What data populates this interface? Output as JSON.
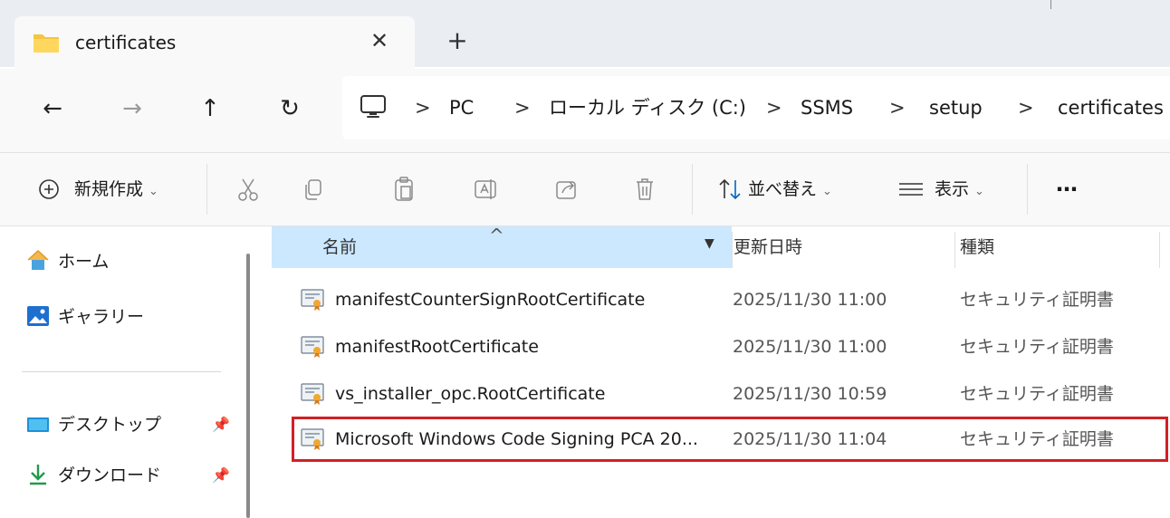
{
  "tab": {
    "title": "certificates",
    "close_glyph": "✕",
    "new_tab_glyph": "+",
    "folder_icon": "folder-icon"
  },
  "nav": {
    "back_glyph": "←",
    "forward_glyph": "→",
    "up_glyph": "↑",
    "refresh_glyph": "↻"
  },
  "breadcrumb": {
    "separator": ">",
    "items": [
      "PC",
      "ローカル ディスク (C:)",
      "SSMS",
      "setup",
      "certificates"
    ]
  },
  "toolbar": {
    "new_label": "新規作成",
    "sort_label": "並べ替え",
    "view_label": "表示",
    "more_glyph": "⋯",
    "chevron": "⌄"
  },
  "sidebar": {
    "items": [
      {
        "label": "ホーム",
        "icon": "home-icon"
      },
      {
        "label": "ギャラリー",
        "icon": "gallery-icon"
      },
      {
        "label": "デスクトップ",
        "icon": "desktop-icon",
        "pinned": true
      },
      {
        "label": "ダウンロード",
        "icon": "download-icon",
        "pinned": true
      }
    ]
  },
  "columns": {
    "name": "名前",
    "date": "更新日時",
    "type": "種類"
  },
  "files": [
    {
      "name": "manifestCounterSignRootCertificate",
      "date": "2025/11/30 11:00",
      "type": "セキュリティ証明書"
    },
    {
      "name": "manifestRootCertificate",
      "date": "2025/11/30 11:00",
      "type": "セキュリティ証明書"
    },
    {
      "name": "vs_installer_opc.RootCertificate",
      "date": "2025/11/30 10:59",
      "type": "セキュリティ証明書"
    },
    {
      "name": "Microsoft Windows Code Signing PCA 20...",
      "date": "2025/11/30 11:04",
      "type": "セキュリティ証明書",
      "highlighted": true
    }
  ],
  "colors": {
    "accent": "#cce8ff",
    "highlight_border": "#d21f26",
    "folder": "#f4c542"
  }
}
